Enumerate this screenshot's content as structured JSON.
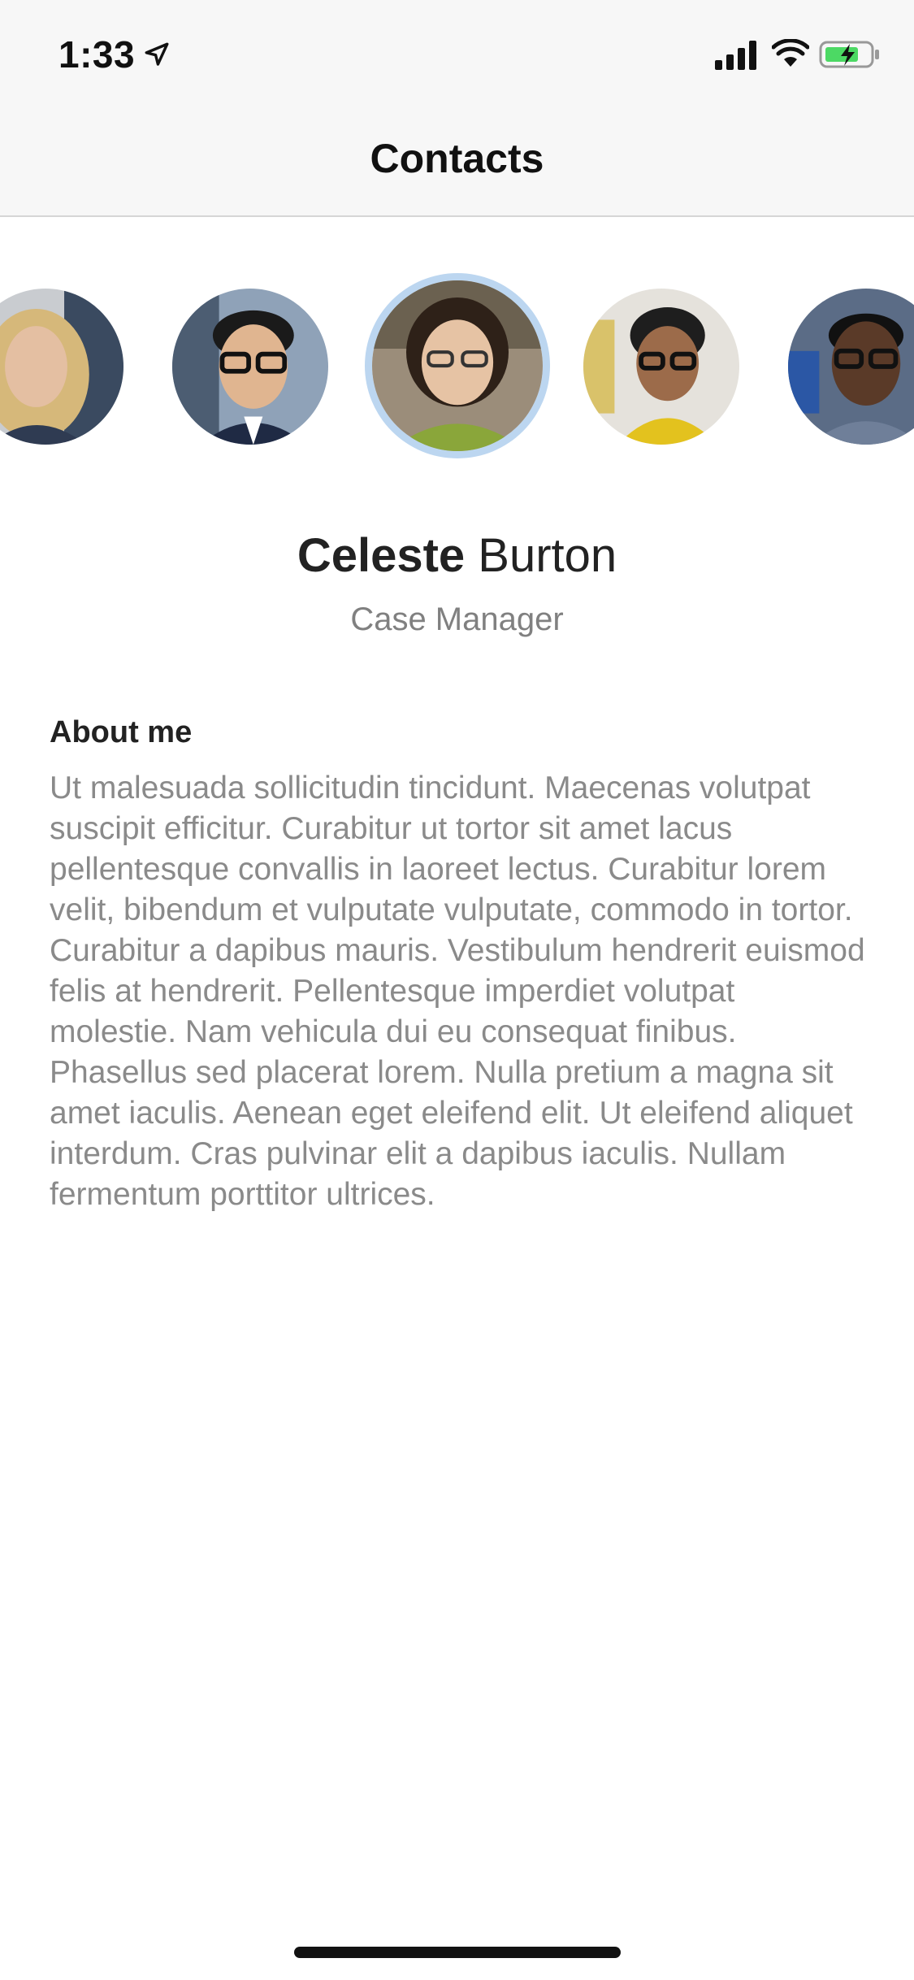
{
  "status_bar": {
    "time": "1:33"
  },
  "header": {
    "title": "Contacts"
  },
  "contacts": [
    {
      "avatar": "woman-blonde-avatar",
      "selected": false
    },
    {
      "avatar": "man-glasses-avatar",
      "selected": false
    },
    {
      "avatar": "woman-glasses-avatar",
      "selected": true
    },
    {
      "avatar": "woman-yellow-scarf-avatar",
      "selected": false
    },
    {
      "avatar": "man-glasses-avatar-2",
      "selected": false
    }
  ],
  "profile": {
    "first_name": "Celeste",
    "last_name": "Burton",
    "role": "Case Manager",
    "about_heading": "About me",
    "about_text": "Ut malesuada sollicitudin tincidunt. Maecenas volutpat suscipit efficitur. Curabitur ut tortor sit amet lacus pellentesque convallis in laoreet lectus. Curabitur lorem velit, bibendum et vulputate vulputate, commodo in tortor. Curabitur a dapibus mauris. Vestibulum hendrerit euismod felis at hendrerit. Pellentesque imperdiet volutpat molestie. Nam vehicula dui eu consequat finibus. Phasellus sed placerat lorem. Nulla pretium a magna sit amet iaculis. Aenean eget eleifend elit. Ut eleifend aliquet interdum. Cras pulvinar elit a dapibus iaculis. Nullam fermentum porttitor ultrices."
  },
  "colors": {
    "selection_ring": "#bcd6f0",
    "battery_charge": "#4cd964",
    "secondary_text": "#8a8a8a"
  }
}
